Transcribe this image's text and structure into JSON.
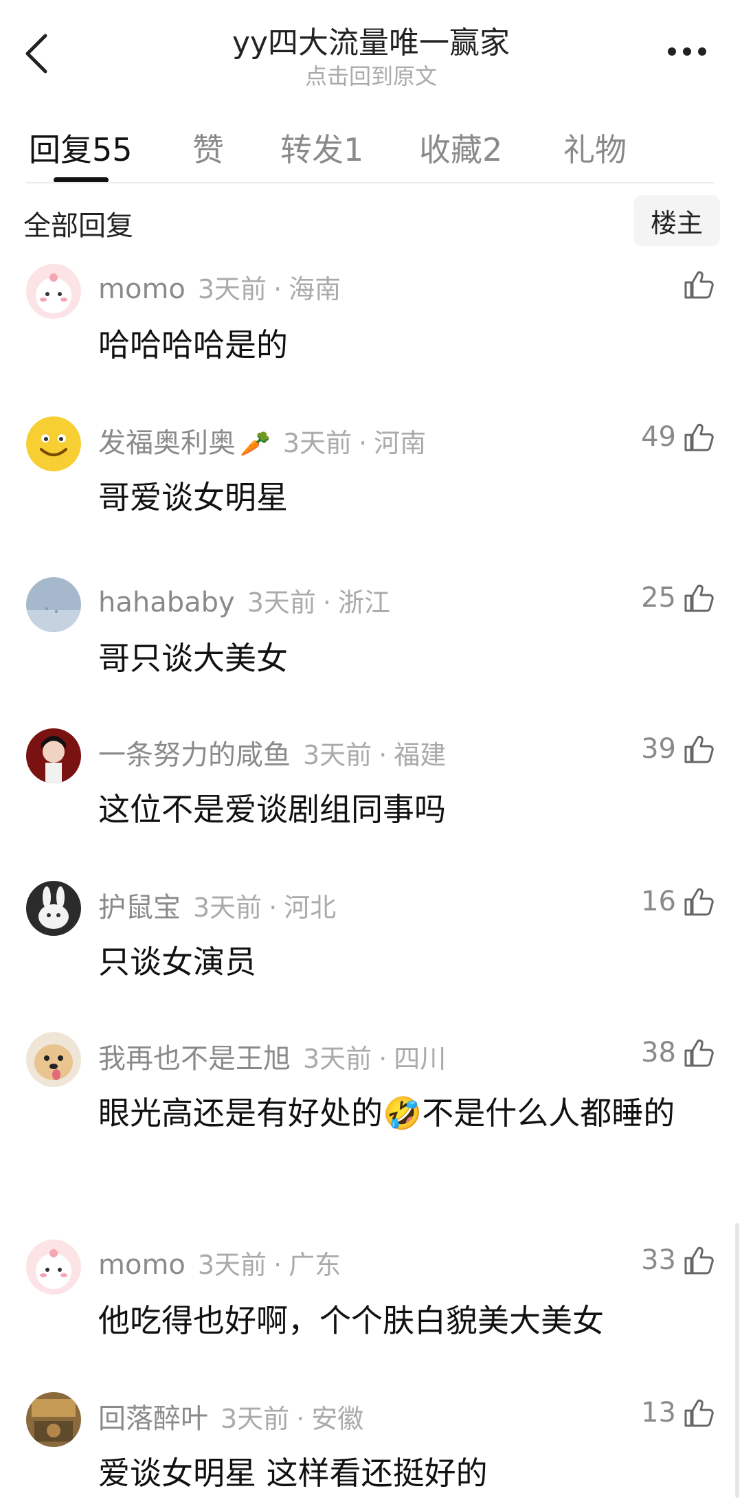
{
  "header": {
    "title": "yy四大流量唯一赢家",
    "subtitle": "点击回到原文"
  },
  "tabs": [
    {
      "label": "回复55",
      "active": true
    },
    {
      "label": "赞",
      "active": false
    },
    {
      "label": "转发1",
      "active": false
    },
    {
      "label": "收藏2",
      "active": false
    },
    {
      "label": "礼物",
      "active": false
    }
  ],
  "filter": {
    "all_label": "全部回复",
    "owner_label": "楼主"
  },
  "comments": [
    {
      "user": "momo",
      "deco": "",
      "time": "3天前",
      "location": "海南",
      "likes": "",
      "text": "哈哈哈哈是的",
      "avatar": "pink-character-avatar"
    },
    {
      "user": "发福奥利奥",
      "deco": "🥕",
      "time": "3天前",
      "location": "河南",
      "likes": "49",
      "text": "哥爱谈女明星",
      "avatar": "smiley-face-avatar"
    },
    {
      "user": "hahababy",
      "deco": "",
      "time": "3天前",
      "location": "浙江",
      "likes": "25",
      "text": "哥只谈大美女",
      "avatar": "blue-sky-avatar"
    },
    {
      "user": "一条努力的咸鱼",
      "deco": "",
      "time": "3天前",
      "location": "福建",
      "likes": "39",
      "text": "这位不是爱谈剧组同事吗",
      "avatar": "red-portrait-avatar"
    },
    {
      "user": "护鼠宝",
      "deco": "",
      "time": "3天前",
      "location": "河北",
      "likes": "16",
      "text": "只谈女演员",
      "avatar": "bunny-avatar"
    },
    {
      "user": "我再也不是王旭",
      "deco": "",
      "time": "3天前",
      "location": "四川",
      "likes": "38",
      "text": "眼光高还是有好处的🤣不是什么人都睡的",
      "avatar": "puppy-avatar"
    },
    {
      "user": "momo",
      "deco": "",
      "time": "3天前",
      "location": "广东",
      "likes": "33",
      "text": "他吃得也好啊，个个肤白貌美大美女",
      "avatar": "pink-character-avatar"
    },
    {
      "user": "回落醉叶",
      "deco": "",
      "time": "3天前",
      "location": "安徽",
      "likes": "13",
      "text": "爱谈女明星 这样看还挺好的",
      "avatar": "photo-avatar"
    }
  ]
}
